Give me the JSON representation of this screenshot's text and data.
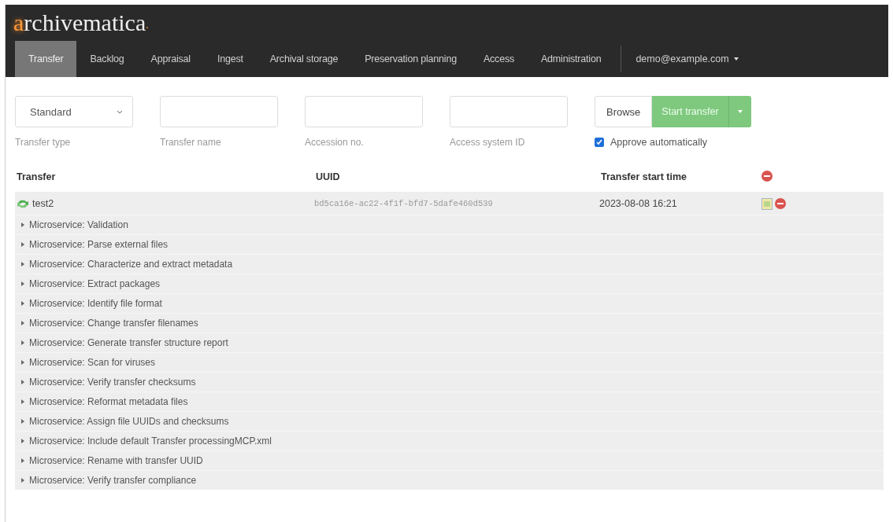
{
  "header": {
    "logo_initial": "a",
    "logo_rest": "rchivematica",
    "logo_dot": "."
  },
  "nav": [
    {
      "label": "Transfer",
      "selected": true
    },
    {
      "label": "Backlog",
      "selected": false
    },
    {
      "label": "Appraisal",
      "selected": false
    },
    {
      "label": "Ingest",
      "selected": false
    },
    {
      "label": "Archival storage",
      "selected": false
    },
    {
      "label": "Preservation planning",
      "selected": false
    },
    {
      "label": "Access",
      "selected": false
    },
    {
      "label": "Administration",
      "selected": false
    }
  ],
  "user_menu": {
    "label": "demo@example.com"
  },
  "form": {
    "transfer_type": {
      "value": "Standard",
      "label": "Transfer type"
    },
    "transfer_name": {
      "label": "Transfer name"
    },
    "accession_no": {
      "label": "Accession no."
    },
    "access_system_id": {
      "label": "Access system ID"
    },
    "browse_button": "Browse",
    "start_button": "Start transfer",
    "approve": {
      "label": "Approve automatically",
      "checked": true
    }
  },
  "table": {
    "columns": [
      "Transfer",
      "UUID",
      "Transfer start time"
    ],
    "rows": [
      {
        "name": "test2",
        "uuid": "bd5ca16e-ac22-4f1f-bfd7-5dafe460d539",
        "start_time": "2023-08-08 16:21",
        "microservices": [
          "Microservice: Validation",
          "Microservice: Parse external files",
          "Microservice: Characterize and extract metadata",
          "Microservice: Extract packages",
          "Microservice: Identify file format",
          "Microservice: Change transfer filenames",
          "Microservice: Generate transfer structure report",
          "Microservice: Scan for viruses",
          "Microservice: Verify transfer checksums",
          "Microservice: Reformat metadata files",
          "Microservice: Assign file UUIDs and checksums",
          "Microservice: Include default Transfer processingMCP.xml",
          "Microservice: Rename with transfer UUID",
          "Microservice: Verify transfer compliance"
        ]
      }
    ]
  }
}
